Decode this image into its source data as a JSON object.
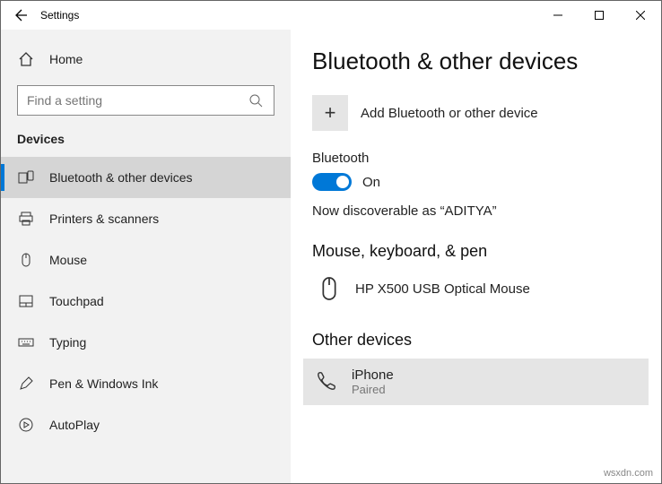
{
  "titlebar": {
    "title": "Settings"
  },
  "sidebar": {
    "home": "Home",
    "search_placeholder": "Find a setting",
    "section": "Devices",
    "items": [
      {
        "label": "Bluetooth & other devices"
      },
      {
        "label": "Printers & scanners"
      },
      {
        "label": "Mouse"
      },
      {
        "label": "Touchpad"
      },
      {
        "label": "Typing"
      },
      {
        "label": "Pen & Windows Ink"
      },
      {
        "label": "AutoPlay"
      }
    ]
  },
  "main": {
    "title": "Bluetooth & other devices",
    "add_label": "Add Bluetooth or other device",
    "bt_label": "Bluetooth",
    "bt_state": "On",
    "discoverable": "Now discoverable as “ADITYA”",
    "group1_title": "Mouse, keyboard, & pen",
    "dev1_name": "HP X500 USB Optical Mouse",
    "group2_title": "Other devices",
    "dev2_name": "iPhone",
    "dev2_status": "Paired"
  },
  "watermark": "wsxdn.com"
}
